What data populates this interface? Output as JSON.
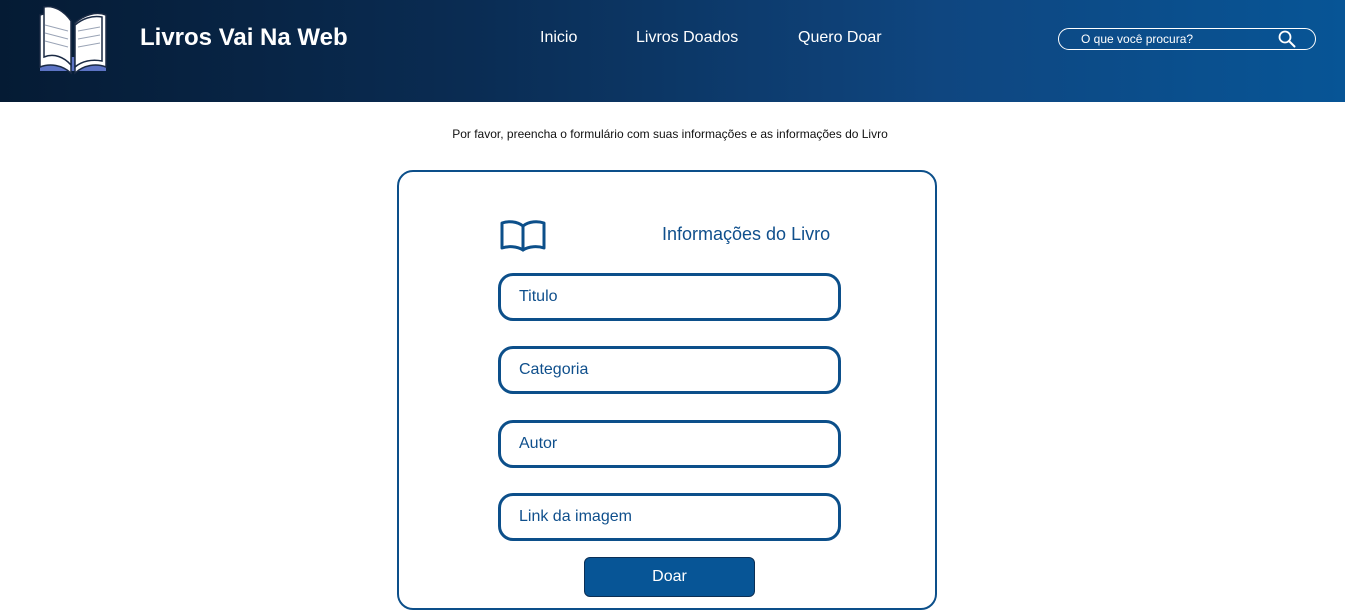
{
  "header": {
    "brand": "Livros Vai Na Web",
    "logo_icon": "open-book-logo-icon",
    "nav": [
      {
        "label": "Inicio"
      },
      {
        "label": "Livros Doados"
      },
      {
        "label": "Quero Doar"
      }
    ],
    "search": {
      "placeholder": "O que você procura?",
      "icon": "search-icon"
    }
  },
  "main": {
    "intro": "Por favor, preencha o formulário com suas informações e as informações do Livro",
    "form": {
      "icon": "book-icon",
      "title": "Informações do Livro",
      "fields": [
        {
          "placeholder": "Titulo"
        },
        {
          "placeholder": "Categoria"
        },
        {
          "placeholder": "Autor"
        },
        {
          "placeholder": "Link da imagem"
        }
      ],
      "submit_label": "Doar"
    }
  },
  "colors": {
    "header_dark": "#051b34",
    "header_light": "#075596",
    "accent": "#0c4f8a",
    "button": "#075596"
  }
}
